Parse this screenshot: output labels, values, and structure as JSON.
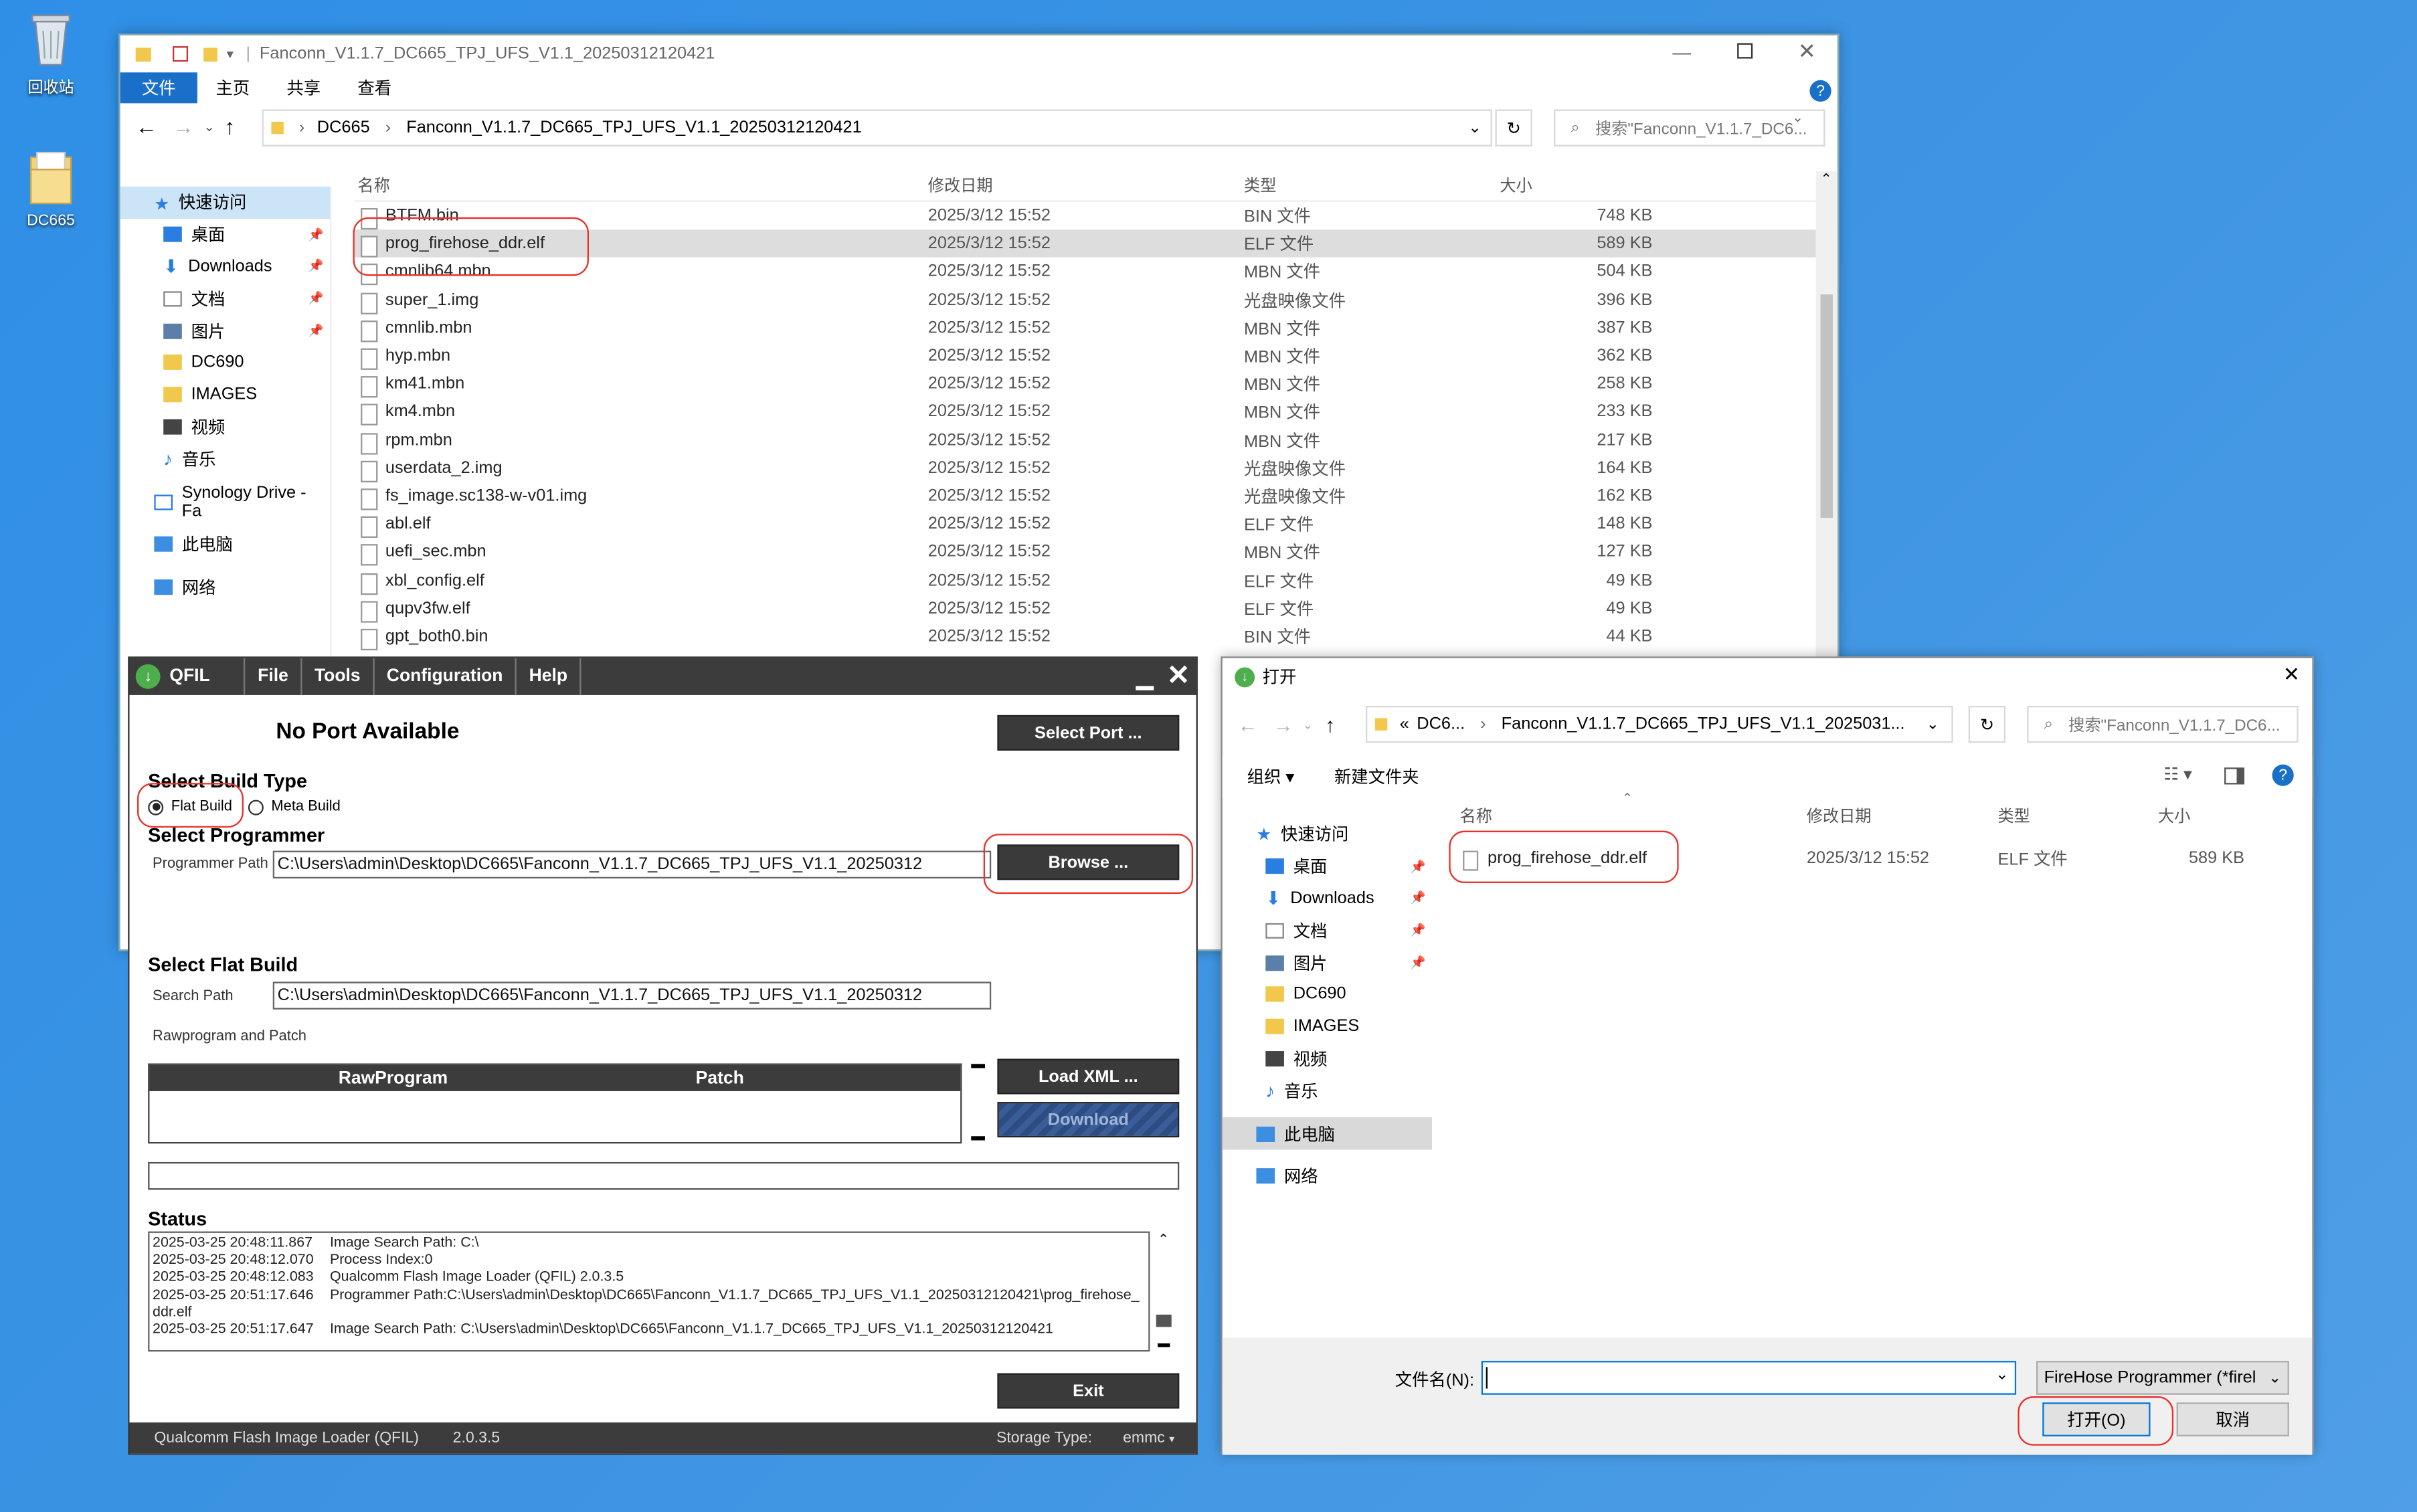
{
  "desktop": {
    "icons": [
      {
        "label": "回收站"
      },
      {
        "label": "DC665"
      }
    ]
  },
  "explorer": {
    "title": "Fanconn_V1.1.7_DC665_TPJ_UFS_V1.1_20250312120421",
    "ribbon": [
      "文件",
      "主页",
      "共享",
      "查看"
    ],
    "breadcrumb": [
      "DC665",
      "Fanconn_V1.1.7_DC665_TPJ_UFS_V1.1_20250312120421"
    ],
    "search_placeholder": "搜索\"Fanconn_V1.1.7_DC6...",
    "nav": [
      {
        "label": "快速访问",
        "pin": false
      },
      {
        "label": "桌面",
        "pin": true
      },
      {
        "label": "Downloads",
        "pin": true
      },
      {
        "label": "文档",
        "pin": true
      },
      {
        "label": "图片",
        "pin": true
      },
      {
        "label": "DC690",
        "pin": false
      },
      {
        "label": "IMAGES",
        "pin": false
      },
      {
        "label": "视频",
        "pin": false
      },
      {
        "label": "音乐",
        "pin": false
      },
      {
        "label": "Synology Drive - Fa",
        "pin": false
      },
      {
        "label": "此电脑",
        "pin": false
      },
      {
        "label": "网络",
        "pin": false
      }
    ],
    "columns": [
      "名称",
      "修改日期",
      "类型",
      "大小"
    ],
    "files": [
      {
        "name": "BTFM.bin",
        "date": "2025/3/12 15:52",
        "type": "BIN 文件",
        "size": "748 KB"
      },
      {
        "name": "prog_firehose_ddr.elf",
        "date": "2025/3/12 15:52",
        "type": "ELF 文件",
        "size": "589 KB"
      },
      {
        "name": "cmnlib64.mbn",
        "date": "2025/3/12 15:52",
        "type": "MBN 文件",
        "size": "504 KB"
      },
      {
        "name": "super_1.img",
        "date": "2025/3/12 15:52",
        "type": "光盘映像文件",
        "size": "396 KB"
      },
      {
        "name": "cmnlib.mbn",
        "date": "2025/3/12 15:52",
        "type": "MBN 文件",
        "size": "387 KB"
      },
      {
        "name": "hyp.mbn",
        "date": "2025/3/12 15:52",
        "type": "MBN 文件",
        "size": "362 KB"
      },
      {
        "name": "km41.mbn",
        "date": "2025/3/12 15:52",
        "type": "MBN 文件",
        "size": "258 KB"
      },
      {
        "name": "km4.mbn",
        "date": "2025/3/12 15:52",
        "type": "MBN 文件",
        "size": "233 KB"
      },
      {
        "name": "rpm.mbn",
        "date": "2025/3/12 15:52",
        "type": "MBN 文件",
        "size": "217 KB"
      },
      {
        "name": "userdata_2.img",
        "date": "2025/3/12 15:52",
        "type": "光盘映像文件",
        "size": "164 KB"
      },
      {
        "name": "fs_image.sc138-w-v01.img",
        "date": "2025/3/12 15:52",
        "type": "光盘映像文件",
        "size": "162 KB"
      },
      {
        "name": "abl.elf",
        "date": "2025/3/12 15:52",
        "type": "ELF 文件",
        "size": "148 KB"
      },
      {
        "name": "uefi_sec.mbn",
        "date": "2025/3/12 15:52",
        "type": "MBN 文件",
        "size": "127 KB"
      },
      {
        "name": "xbl_config.elf",
        "date": "2025/3/12 15:52",
        "type": "ELF 文件",
        "size": "49 KB"
      },
      {
        "name": "qupv3fw.elf",
        "date": "2025/3/12 15:52",
        "type": "ELF 文件",
        "size": "49 KB"
      },
      {
        "name": "gpt_both0.bin",
        "date": "2025/3/12 15:52",
        "type": "BIN 文件",
        "size": "44 KB"
      }
    ]
  },
  "qfil": {
    "app": "QFIL",
    "menu": [
      "File",
      "Tools",
      "Configuration",
      "Help"
    ],
    "port": "No Port Available",
    "select_port": "Select Port ...",
    "build_type_label": "Select Build Type",
    "flat_build": "Flat Build",
    "meta_build": "Meta Build",
    "programmer_label": "Select Programmer",
    "programmer_path_label": "Programmer Path",
    "programmer_path": "C:\\Users\\admin\\Desktop\\DC665\\Fanconn_V1.1.7_DC665_TPJ_UFS_V1.1_20250312",
    "browse": "Browse ...",
    "flat_label": "Select Flat Build",
    "search_path_label": "Search Path",
    "search_path": "C:\\Users\\admin\\Desktop\\DC665\\Fanconn_V1.1.7_DC665_TPJ_UFS_V1.1_20250312",
    "rawprogram_label": "Rawprogram and Patch",
    "col_raw": "RawProgram",
    "col_patch": "Patch",
    "load_xml": "Load XML ...",
    "download": "Download",
    "status_label": "Status",
    "status": [
      {
        "ts": "2025-03-25 20:48:11.867",
        "msg": "Image Search Path: C:\\"
      },
      {
        "ts": "2025-03-25 20:48:12.070",
        "msg": "Process Index:0"
      },
      {
        "ts": "2025-03-25 20:48:12.083",
        "msg": "Qualcomm Flash Image Loader (QFIL) 2.0.3.5"
      },
      {
        "ts": "2025-03-25 20:51:17.646",
        "msg": "Programmer Path:C:\\Users\\admin\\Desktop\\DC665\\Fanconn_V1.1.7_DC665_TPJ_UFS_V1.1_20250312120421\\prog_firehose_"
      },
      {
        "ts": "ddr.elf",
        "msg": ""
      },
      {
        "ts": "2025-03-25 20:51:17.647",
        "msg": "Image Search Path: C:\\Users\\admin\\Desktop\\DC665\\Fanconn_V1.1.7_DC665_TPJ_UFS_V1.1_20250312120421"
      }
    ],
    "exit": "Exit",
    "footer_name": "Qualcomm Flash Image Loader (QFIL)",
    "footer_ver": "2.0.3.5",
    "storage_label": "Storage Type:",
    "storage_value": "emmc"
  },
  "open": {
    "title": "打开",
    "breadcrumb_prefix": "«",
    "breadcrumb": [
      "DC6...",
      "Fanconn_V1.1.7_DC665_TPJ_UFS_V1.1_2025031..."
    ],
    "search_placeholder": "搜索\"Fanconn_V1.1.7_DC6...",
    "organize": "组织 ▾",
    "new_folder": "新建文件夹",
    "nav": [
      "快速访问",
      "桌面",
      "Downloads",
      "文档",
      "图片",
      "DC690",
      "IMAGES",
      "视频",
      "音乐",
      "此电脑",
      "网络"
    ],
    "columns": [
      "名称",
      "修改日期",
      "类型",
      "大小"
    ],
    "file": {
      "name": "prog_firehose_ddr.elf",
      "date": "2025/3/12 15:52",
      "type": "ELF 文件",
      "size": "589 KB"
    },
    "filename_label": "文件名(N):",
    "filename_value": "",
    "filter": "FireHose Programmer (*firel",
    "open_btn": "打开(O)",
    "cancel_btn": "取消"
  }
}
